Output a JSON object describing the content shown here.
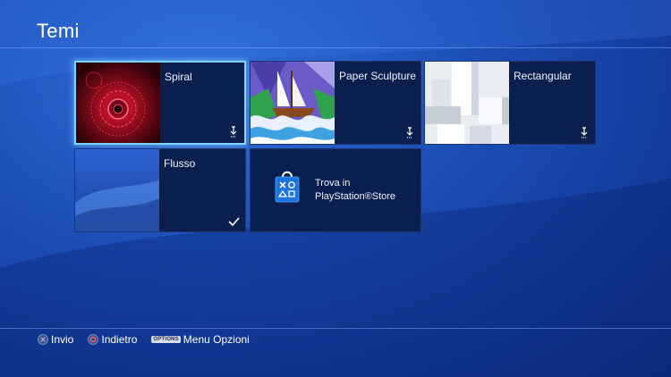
{
  "screen": {
    "title": "Temi"
  },
  "themes": [
    {
      "name": "Spiral",
      "status": "download"
    },
    {
      "name": "Paper Sculpture",
      "status": "download"
    },
    {
      "name": "Rectangular",
      "status": "download"
    },
    {
      "name": "Flusso",
      "status": "installed"
    }
  ],
  "store": {
    "line1": "Trova in",
    "line2": "PlayStation®Store"
  },
  "footer": {
    "enter_label": "Invio",
    "back_label": "Indietro",
    "options_key": "OPTIONS",
    "options_label": "Menu Opzioni"
  },
  "colors": {
    "selection": "#7fd2ff",
    "tile_bg": "#0b1f4f",
    "background": "#1d4fb8"
  }
}
